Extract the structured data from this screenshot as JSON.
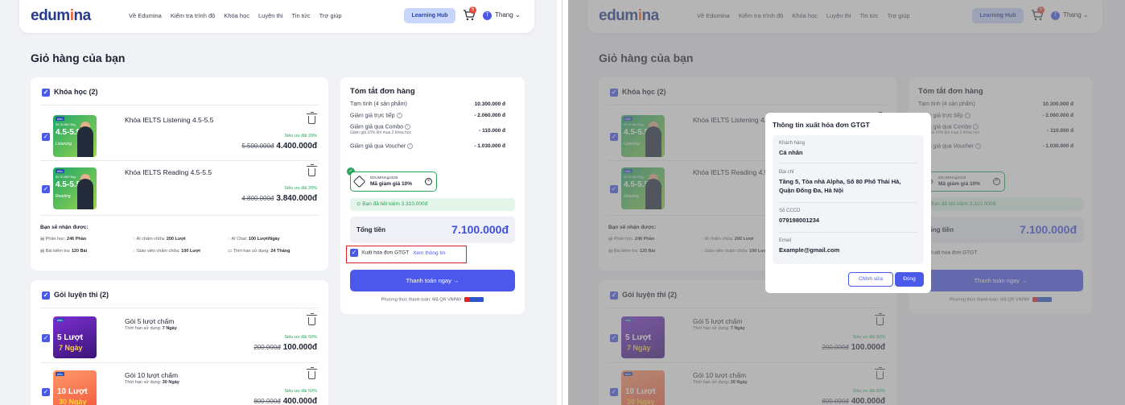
{
  "header": {
    "logo_main": "edum",
    "logo_accent": "i",
    "logo_end": "na",
    "menu": [
      "Về Edumina",
      "Kiểm tra trình độ",
      "Khóa học",
      "Luyện thi",
      "Tin tức",
      "Trợ giúp"
    ],
    "learning_hub": "Learning Hub",
    "cart_count": "5",
    "avatar_letter": "T",
    "user_name": "Thang ⌄"
  },
  "page_title": "Giỏ hàng của bạn",
  "courses": {
    "heading": "Khóa học (2)",
    "items": [
      {
        "name": "Khóa IELTS Listening 4.5-5.5",
        "thumb_band": "4.5-5.5",
        "thumb_skill": "Listening",
        "thumb_small": "IELTS Bắt Tổng",
        "discount": "Siêu ưu đãi 20%",
        "old_price": "5.500.000đ",
        "price": "4.400.000đ"
      },
      {
        "name": "Khóa IELTS Reading 4.5-5.5",
        "thumb_band": "4.5-5.5",
        "thumb_skill": "Reading",
        "thumb_small": "IELTS Bắt Tổng",
        "discount": "Siêu ưu đãi 20%",
        "old_price": "4.800.000đ",
        "price": "3.840.000đ"
      }
    ],
    "benefits_title": "Bạn sẽ nhận được:",
    "benefits": [
      {
        "label": "Phần học:",
        "value": "246 Phần"
      },
      {
        "label": "AI chấm chữa:",
        "value": "200 Lượt"
      },
      {
        "label": "AI Chat:",
        "value": "100 Lượt/Ngày"
      },
      {
        "label": "Bài kiểm tra:",
        "value": "120 Bài"
      },
      {
        "label": "Giáo viên chấm chữa:",
        "value": "100 Lượt"
      },
      {
        "label": "Thời hạn sử dụng:",
        "value": "24 Tháng"
      }
    ]
  },
  "exams": {
    "heading": "Gói luyện thi (2)",
    "items": [
      {
        "name": "Gói 5 lượt chấm",
        "thumb_l1": "5 Lượt",
        "thumb_l2": "7 Ngày",
        "validity_label": "Thời hạn sử dụng:",
        "validity": "7 Ngày",
        "discount": "Siêu ưu đãi 50%",
        "old_price": "200.000đ",
        "price": "100.000đ"
      },
      {
        "name": "Gói 10 lượt chấm",
        "thumb_l1": "10 Lượt",
        "thumb_l2": "30 Ngày",
        "validity_label": "Thời hạn sử dụng:",
        "validity": "30 Ngày",
        "discount": "Siêu ưu đãi 50%",
        "old_price": "800.000đ",
        "price": "400.000đ"
      }
    ]
  },
  "summary": {
    "title": "Tóm tắt đơn hàng",
    "subtotal_label": "Tạm tính (4 sản phẩm)",
    "subtotal": "10.300.000 đ",
    "direct_label": "Giảm giá trực tiếp",
    "direct": "- 2.060.000 đ",
    "combo_label": "Giảm giá qua Combo",
    "combo_note": "Giảm giá 10% khi mua 2 khóa học",
    "combo": "- 110.000 đ",
    "voucher_label": "Giảm giá qua Voucher",
    "voucher": "- 1.030.000 đ",
    "voucher_code": "EDUMINAgi2025",
    "voucher_name": "Mã giảm giá 10%",
    "saved": "Bạn đã tiết kiệm 3.310.000đ",
    "total_label": "Tổng tiền",
    "total": "7.100.000đ",
    "invoice_label": "Xuất hóa đơn GTGT",
    "invoice_link": "Xem thông tin",
    "pay_button": "Thanh toán ngay →",
    "payment_methods": "Phương thức thanh toán: Mã QR VNPAY"
  },
  "modal": {
    "title": "Thông tin xuất hóa đơn GTGT",
    "customer_label": "Khách hàng",
    "customer": "Cá nhân",
    "address_label": "Địa chỉ",
    "address": "Tầng 5, Tòa nhà Alpha, Số 80 Phố Thái Hà, Quận Đống Đa, Hà Nội",
    "id_label": "Số CCCD",
    "id": "079198001234",
    "email_label": "Email",
    "email": "Example@gmail.com",
    "edit_button": "Chỉnh sửa",
    "close_button": "Đóng"
  },
  "colors": {
    "primary": "#4c58ec",
    "success": "#2aa35a",
    "highlight": "#e0232b",
    "brand": "#243b8f"
  }
}
